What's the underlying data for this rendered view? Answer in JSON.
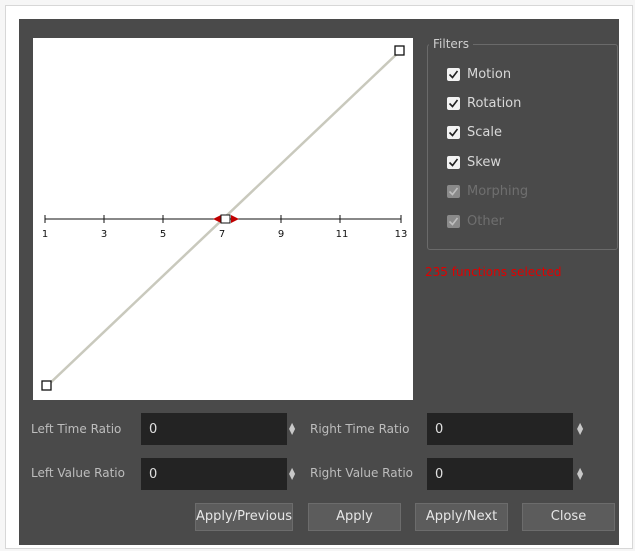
{
  "filters": {
    "title": "Filters",
    "items": [
      {
        "label": "Motion",
        "checked": true,
        "enabled": true
      },
      {
        "label": "Rotation",
        "checked": true,
        "enabled": true
      },
      {
        "label": "Scale",
        "checked": true,
        "enabled": true
      },
      {
        "label": "Skew",
        "checked": true,
        "enabled": true
      },
      {
        "label": "Morphing",
        "checked": true,
        "enabled": false
      },
      {
        "label": "Other",
        "checked": true,
        "enabled": false
      }
    ]
  },
  "status": {
    "functions_selected": "235 functions selected",
    "color": "#e00000"
  },
  "graph": {
    "axis_ticks": [
      "1",
      "3",
      "5",
      "7",
      "9",
      "11",
      "13"
    ],
    "curve_color": "#c9c9bd",
    "handle_color": "#c00000"
  },
  "fields": {
    "left_time_ratio": {
      "label": "Left Time Ratio",
      "value": "0"
    },
    "right_time_ratio": {
      "label": "Right Time Ratio",
      "value": "0"
    },
    "left_value_ratio": {
      "label": "Left Value Ratio",
      "value": "0"
    },
    "right_value_ratio": {
      "label": "Right Value Ratio",
      "value": "0"
    }
  },
  "buttons": {
    "apply_previous": "Apply/Previous",
    "apply": "Apply",
    "apply_next": "Apply/Next",
    "close": "Close"
  }
}
